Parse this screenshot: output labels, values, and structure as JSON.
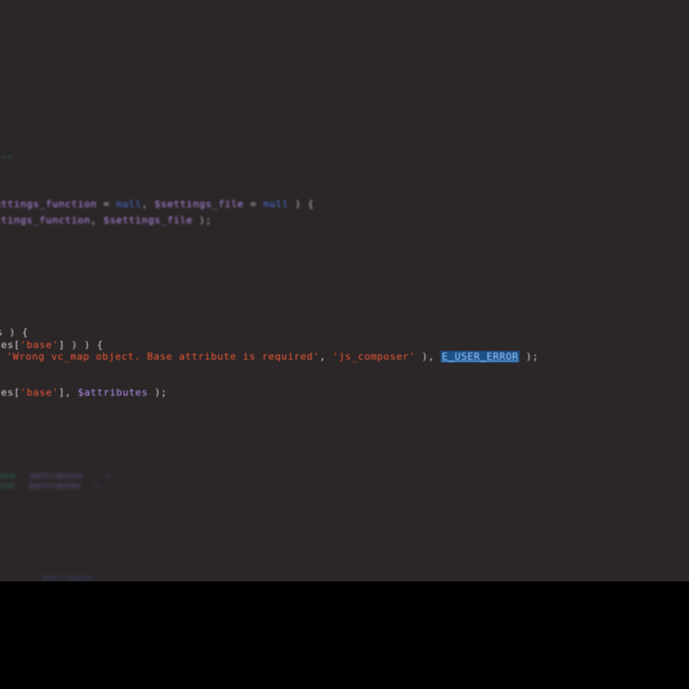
{
  "editor": {
    "lines": [
      {
        "id": "l1",
        "segments": [
          {
            "t": "--",
            "c": "teal"
          }
        ]
      },
      {
        "id": "l2",
        "segments": [
          {
            "t": "ettings_function",
            "c": "var"
          },
          {
            "t": " = ",
            "c": "punc"
          },
          {
            "t": "null",
            "c": "kw"
          },
          {
            "t": ", ",
            "c": "punc"
          },
          {
            "t": "$settings_file",
            "c": "var"
          },
          {
            "t": " = ",
            "c": "punc"
          },
          {
            "t": "null",
            "c": "kw"
          },
          {
            "t": " ) {",
            "c": "punc"
          }
        ]
      },
      {
        "id": "l3",
        "segments": [
          {
            "t": "ttings_function",
            "c": "var"
          },
          {
            "t": ", ",
            "c": "punc"
          },
          {
            "t": "$settings_file",
            "c": "var"
          },
          {
            "t": " );",
            "c": "punc"
          }
        ]
      },
      {
        "id": "l4",
        "segments": [
          {
            "t": "s ) {",
            "c": "plain"
          }
        ]
      },
      {
        "id": "l5",
        "segments": [
          {
            "t": "tes[",
            "c": "plain"
          },
          {
            "t": "'base'",
            "c": "str"
          },
          {
            "t": "] ) ) {",
            "c": "plain"
          }
        ]
      },
      {
        "id": "l6",
        "segments": [
          {
            "t": " ",
            "c": "plain"
          },
          {
            "t": "'Wrong vc_map object. Base attribute is required'",
            "c": "str"
          },
          {
            "t": ", ",
            "c": "plain"
          },
          {
            "t": "'js_composer'",
            "c": "str"
          },
          {
            "t": " ), ",
            "c": "plain"
          },
          {
            "t": "E_USER_ERROR",
            "c": "hl"
          },
          {
            "t": " );",
            "c": "plain"
          }
        ]
      },
      {
        "id": "l7",
        "segments": [
          {
            "t": "tes[",
            "c": "plain"
          },
          {
            "t": "'base'",
            "c": "str"
          },
          {
            "t": "], ",
            "c": "plain"
          },
          {
            "t": "$attributes",
            "c": "var"
          },
          {
            "t": " );",
            "c": "plain"
          }
        ]
      },
      {
        "id": "l8",
        "segments": [
          {
            "t": "ribute",
            "c": "green"
          },
          {
            "t": "   ",
            "c": "plain"
          },
          {
            "t": "$attributes",
            "c": "purple"
          },
          {
            "t": "  -  >",
            "c": "dimblue"
          }
        ]
      },
      {
        "id": "l9",
        "segments": [
          {
            "t": "ribute",
            "c": "green"
          },
          {
            "t": "   ",
            "c": "plain"
          },
          {
            "t": "$attributes",
            "c": "purple"
          },
          {
            "t": "  ->",
            "c": "dimblue"
          }
        ]
      },
      {
        "id": "l10",
        "segments": [
          {
            "t": "---- ",
            "c": "dimblue"
          },
          {
            "t": "$attributes",
            "c": "dimblue"
          }
        ]
      }
    ]
  }
}
